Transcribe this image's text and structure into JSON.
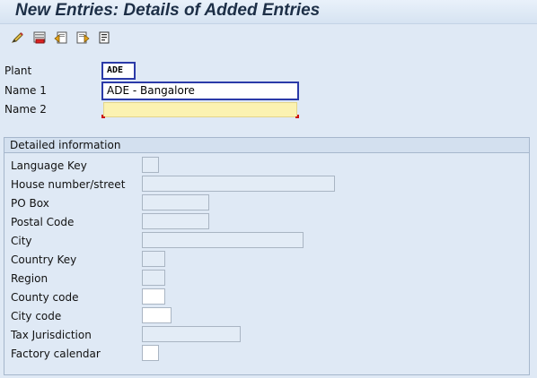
{
  "title": "New Entries: Details of Added Entries",
  "toolbar": {
    "buttons": [
      "display-change-icon",
      "delete-icon",
      "previous-entry-icon",
      "next-entry-icon",
      "details-icon"
    ]
  },
  "header": {
    "plant": {
      "label": "Plant",
      "value": "ADE"
    },
    "name1": {
      "label": "Name 1",
      "value": "ADE - Bangalore"
    },
    "name2": {
      "label": "Name 2",
      "value": ""
    }
  },
  "detail": {
    "title": "Detailed information",
    "fields": {
      "language_key": {
        "label": "Language Key",
        "value": ""
      },
      "house_number": {
        "label": "House number/street",
        "value": ""
      },
      "po_box": {
        "label": "PO Box",
        "value": ""
      },
      "postal_code": {
        "label": "Postal Code",
        "value": ""
      },
      "city": {
        "label": "City",
        "value": ""
      },
      "country_key": {
        "label": "Country Key",
        "value": ""
      },
      "region": {
        "label": "Region",
        "value": ""
      },
      "county_code": {
        "label": "County code",
        "value": ""
      },
      "city_code": {
        "label": "City code",
        "value": ""
      },
      "tax_jurisdiction": {
        "label": "Tax Jurisdiction",
        "value": ""
      },
      "factory_calendar": {
        "label": "Factory calendar",
        "value": ""
      }
    }
  },
  "colors": {
    "background": "#dfe9f5",
    "title_text": "#1d2f47",
    "focus_border": "#2b3aa8",
    "required_fill": "#fbf2b1",
    "required_marker": "#cc1111"
  }
}
